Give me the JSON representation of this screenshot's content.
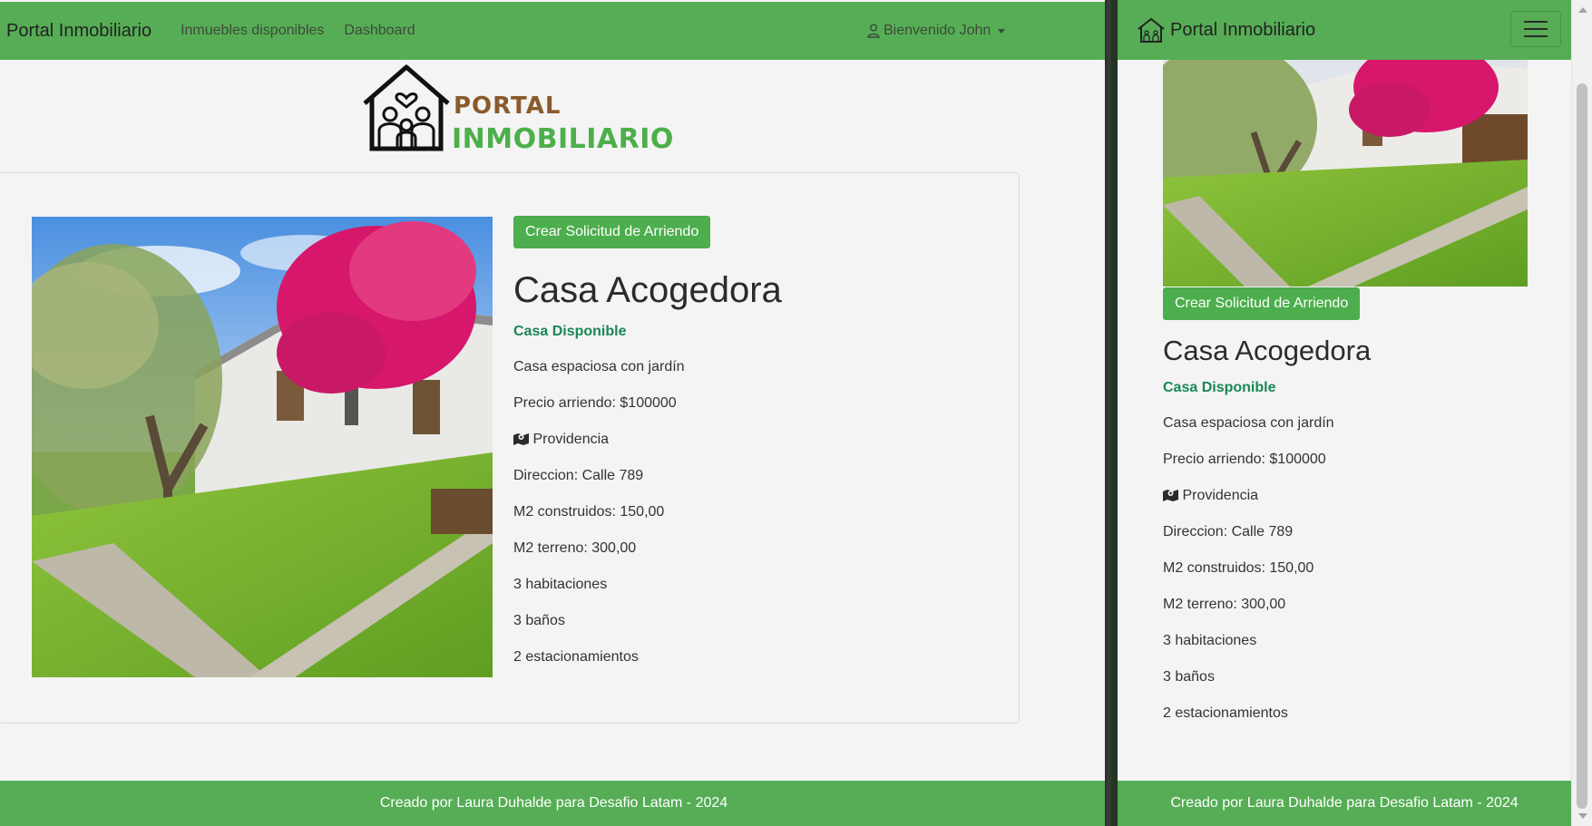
{
  "navbar": {
    "brand": "Portal Inmobiliario",
    "links": [
      "Inmuebles disponibles",
      "Dashboard"
    ],
    "user_label": "Bienvenido John"
  },
  "logo": {
    "line1": "PORTAL",
    "line2": "INMOBILIARIO"
  },
  "property": {
    "action_button": "Crear Solicitud de Arriendo",
    "title": "Casa Acogedora",
    "status": "Casa Disponible",
    "description": "Casa espaciosa con jardín",
    "price": "Precio arriendo: $100000",
    "commune": "Providencia",
    "address": "Direccion: Calle 789",
    "m2_built": "M2 construidos: 150,00",
    "m2_land": "M2 terreno: 300,00",
    "rooms": "3 habitaciones",
    "bathrooms": "3 baños",
    "parking": "2 estacionamientos"
  },
  "footer": {
    "text": "Creado por Laura Duhalde para Desafio Latam - 2024"
  },
  "colors": {
    "navbar_green": "#56ad55",
    "button_green": "#4cae4c",
    "status_green": "#198754",
    "logo_brown": "#8a5a2b",
    "logo_green": "#4cb04a"
  },
  "icons": {
    "user": "person-icon",
    "map": "map-marker-icon",
    "menu": "hamburger-icon",
    "logo": "house-family-icon"
  }
}
